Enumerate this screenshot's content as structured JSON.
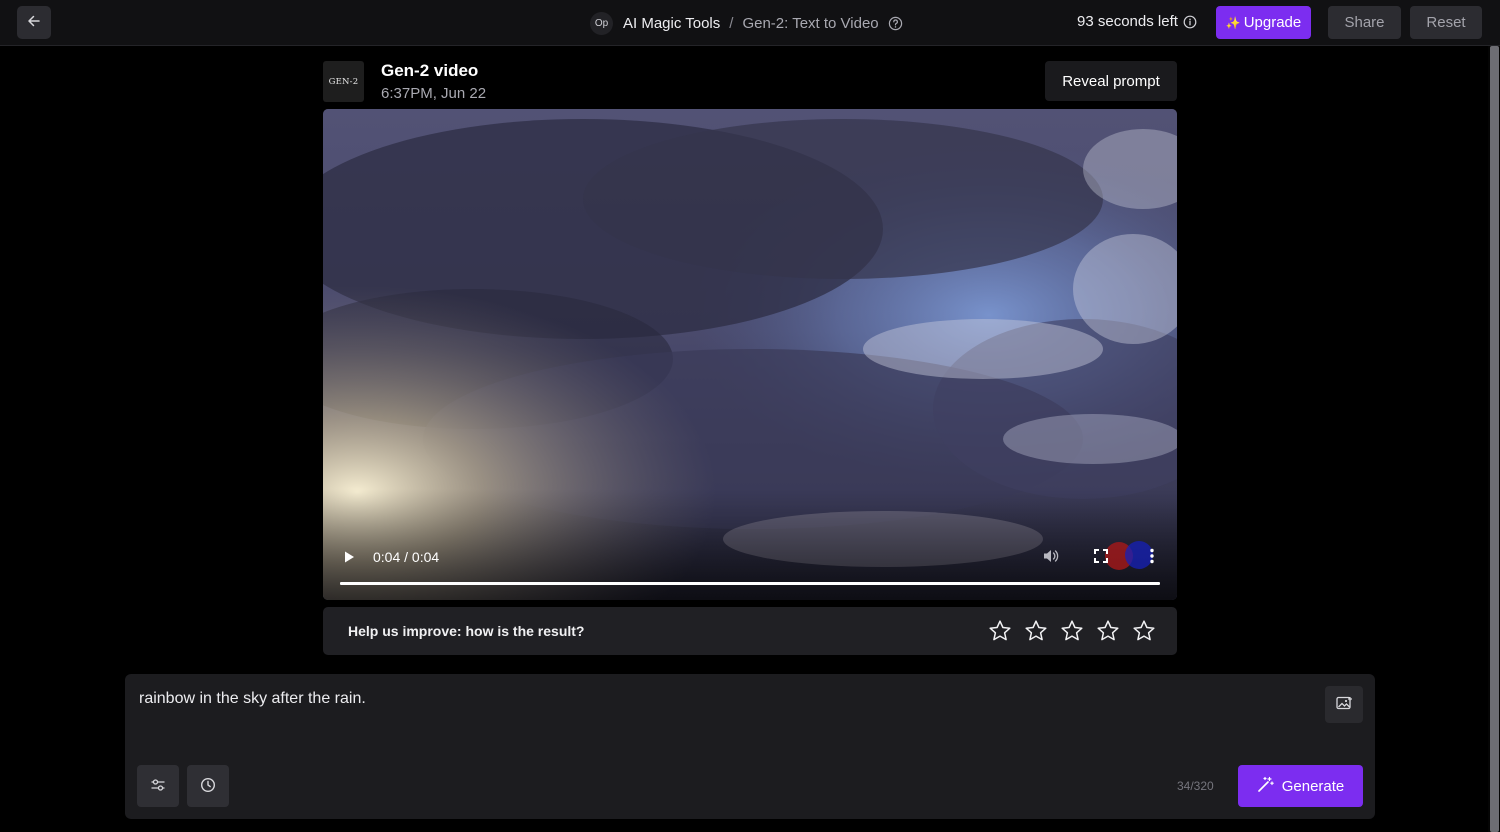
{
  "topbar": {
    "workspace_badge": "Op",
    "breadcrumb_root": "AI Magic Tools",
    "breadcrumb_separator": "/",
    "breadcrumb_current": "Gen-2: Text to Video",
    "timer_text": "93 seconds left",
    "upgrade_label": "Upgrade",
    "upgrade_sparkle": "✨",
    "share_label": "Share",
    "reset_label": "Reset",
    "accent_color": "#7c2df0"
  },
  "result": {
    "thumb_label": "GEN-2",
    "title": "Gen-2 video",
    "timestamp": "6:37PM, Jun 22",
    "reveal_label": "Reveal prompt"
  },
  "video": {
    "time_display": "0:04 / 0:04",
    "progress": 1.0
  },
  "feedback": {
    "question": "Help us improve: how is the result?",
    "stars_total": 5,
    "stars_selected": 0
  },
  "prompt": {
    "text": "rainbow in the sky after the rain.",
    "char_count": "34/320",
    "generate_label": "Generate"
  },
  "icons": {
    "back": "arrow-left-icon",
    "help": "question-circle-icon",
    "info": "info-circle-icon",
    "play": "play-icon",
    "volume": "volume-icon",
    "fullscreen": "fullscreen-icon",
    "more": "more-vertical-icon",
    "star": "star-outline-icon",
    "image": "image-upload-icon",
    "settings": "sliders-icon",
    "history": "clock-icon",
    "generate": "magic-wand-icon"
  }
}
